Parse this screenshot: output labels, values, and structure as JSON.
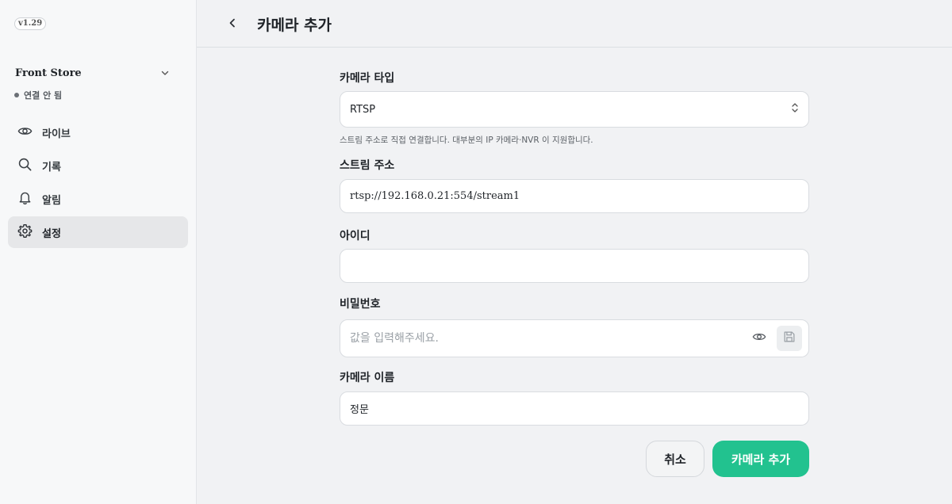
{
  "app": {
    "version": "v1.29"
  },
  "sidebar": {
    "store_name": "Front Store",
    "status_text": "연결 안 됨",
    "items": [
      {
        "label": "라이브",
        "icon": "eye-icon"
      },
      {
        "label": "기록",
        "icon": "search-icon"
      },
      {
        "label": "알림",
        "icon": "bell-icon"
      },
      {
        "label": "설정",
        "icon": "gear-icon",
        "active": true
      }
    ]
  },
  "header": {
    "title": "카메라 추가"
  },
  "form": {
    "camera_type": {
      "label": "카메라 타입",
      "value": "RTSP",
      "help": "스트림 주소로 직접 연결합니다. 대부분의 IP 카메라·NVR 이 지원합니다."
    },
    "stream_url": {
      "label": "스트림 주소",
      "value": "rtsp://192.168.0.21:554/stream1"
    },
    "username": {
      "label": "아이디",
      "value": ""
    },
    "password": {
      "label": "비밀번호",
      "placeholder": "값을 입력해주세요."
    },
    "camera_name": {
      "label": "카메라 이름",
      "value": "정문"
    }
  },
  "actions": {
    "cancel_label": "취소",
    "submit_label": "카메라 추가"
  },
  "colors": {
    "primary": "#22c28f",
    "background": "#f1f2f4",
    "sidebar_bg": "#f7f8f9"
  }
}
